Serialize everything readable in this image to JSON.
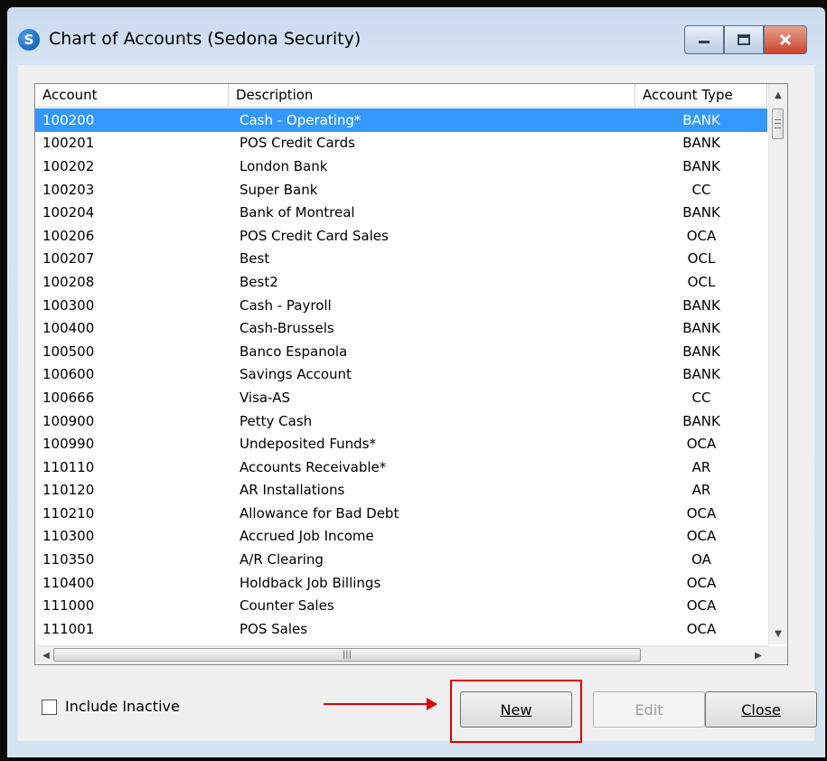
{
  "window": {
    "title": "Chart of Accounts (Sedona Security)",
    "app_icon_letter": "S"
  },
  "table": {
    "columns": [
      "Account",
      "Description",
      "Account Type"
    ],
    "selected_index": 0,
    "rows": [
      {
        "account": "100200",
        "description": "Cash - Operating*",
        "type": "BANK"
      },
      {
        "account": "100201",
        "description": "POS Credit Cards",
        "type": "BANK"
      },
      {
        "account": "100202",
        "description": "London Bank",
        "type": "BANK"
      },
      {
        "account": "100203",
        "description": "Super Bank",
        "type": "CC"
      },
      {
        "account": "100204",
        "description": "Bank of Montreal",
        "type": "BANK"
      },
      {
        "account": "100206",
        "description": "POS Credit Card Sales",
        "type": "OCA"
      },
      {
        "account": "100207",
        "description": "Best",
        "type": "OCL"
      },
      {
        "account": "100208",
        "description": "Best2",
        "type": "OCL"
      },
      {
        "account": "100300",
        "description": "Cash - Payroll",
        "type": "BANK"
      },
      {
        "account": "100400",
        "description": "Cash-Brussels",
        "type": "BANK"
      },
      {
        "account": "100500",
        "description": "Banco Espanola",
        "type": "BANK"
      },
      {
        "account": "100600",
        "description": "Savings Account",
        "type": "BANK"
      },
      {
        "account": "100666",
        "description": "Visa-AS",
        "type": "CC"
      },
      {
        "account": "100900",
        "description": "Petty Cash",
        "type": "BANK"
      },
      {
        "account": "100990",
        "description": "Undeposited Funds*",
        "type": "OCA"
      },
      {
        "account": "110110",
        "description": "Accounts Receivable*",
        "type": "AR"
      },
      {
        "account": "110120",
        "description": "AR Installations",
        "type": "AR"
      },
      {
        "account": "110210",
        "description": "Allowance for Bad Debt",
        "type": "OCA"
      },
      {
        "account": "110300",
        "description": "Accrued Job Income",
        "type": "OCA"
      },
      {
        "account": "110350",
        "description": "A/R Clearing",
        "type": "OA"
      },
      {
        "account": "110400",
        "description": "Holdback Job Billings",
        "type": "OCA"
      },
      {
        "account": "111000",
        "description": "Counter Sales",
        "type": "OCA"
      },
      {
        "account": "111001",
        "description": "POS Sales",
        "type": "OCA"
      }
    ]
  },
  "include_inactive": {
    "label": "Include Inactive",
    "checked": false
  },
  "buttons": {
    "new": "New",
    "edit": "Edit",
    "close": "Close"
  },
  "colors": {
    "selection": "#3399ff",
    "annotation": "#e00000"
  }
}
